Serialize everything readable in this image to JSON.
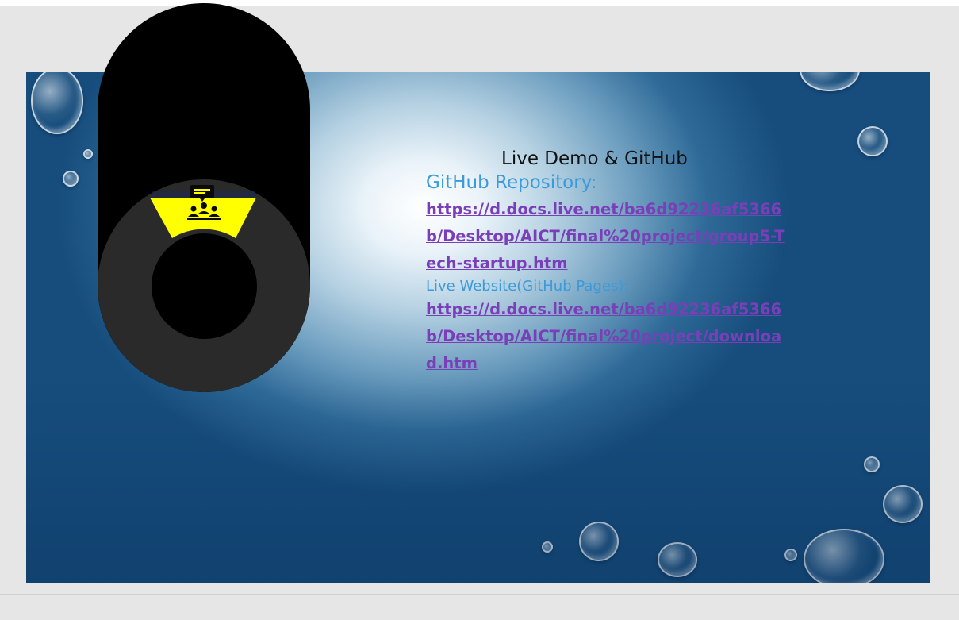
{
  "slide": {
    "title": "Live Demo & GitHub",
    "github_label": "GitHub Repository:",
    "github_url": "https://d.docs.live.net/ba6d92236af5366b/Desktop/AICT/final%20project/group5-Tech-startup.htm",
    "pages_label": "Live Website(GitHub Pages):",
    "pages_url": "https://d.docs.live.net/ba6d92236af5366b/Desktop/AICT/final%20project/download.htm"
  },
  "overlay": {
    "icon": "meeting-icon",
    "accent_color": "#ffff00"
  },
  "colors": {
    "label": "#3b9ad9",
    "link": "#7a3fb8",
    "title": "#111111"
  }
}
